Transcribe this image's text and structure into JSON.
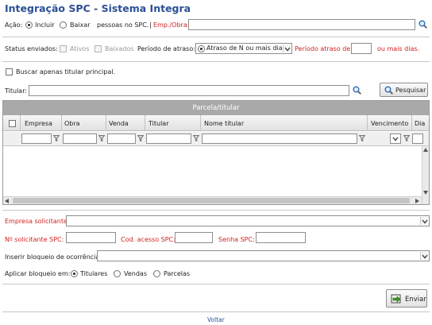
{
  "title": "Integração SPC - Sistema Integra",
  "acao": {
    "label": "Ação:",
    "incluir": "Incluir",
    "baixar": "Baixar",
    "suffix": "pessoas no SPC.",
    "pipe": "|",
    "emp_obra": "Emp./Obra:",
    "selected": "Incluir"
  },
  "status": {
    "label": "Status enviados:",
    "ativos": "Ativos",
    "baixados": "Baixados",
    "periodo_label": "Período de atraso:",
    "periodo_value": "Atraso de N ou mais dias",
    "periodo_atraso_de": "Período atraso de:",
    "ou_mais_dias": "ou mais dias."
  },
  "buscar_titular": "Buscar apenas titular principal.",
  "titular": {
    "label": "Titular:",
    "pesquisar": "Pesquisar"
  },
  "grid": {
    "title": "Parcela/titular",
    "columns": [
      "Empresa",
      "Obra",
      "Venda",
      "Titular",
      "Nome titular",
      "Vencimento",
      "Dia"
    ]
  },
  "form": {
    "empresa_solicitante": "Empresa solicitante:",
    "n_solicitante": "Nº solicitante SPC:",
    "cod_acesso": "Cod. acesso SPC:",
    "senha": "Senha SPC:",
    "inserir_bloqueio": "Inserir bloqueio de ocorrência:",
    "aplicar_bloqueio": "Aplicar bloqueio em:",
    "titulares": "Titulares",
    "vendas": "Vendas",
    "parcelas": "Parcelas",
    "aplicar_selected": "Titulares"
  },
  "enviar": "Enviar",
  "voltar": "Voltar",
  "colors": {
    "title": "#2b4f96",
    "required_label": "#d21f1f",
    "grid_header": "#a9a9a9",
    "link": "#2b4f96"
  }
}
